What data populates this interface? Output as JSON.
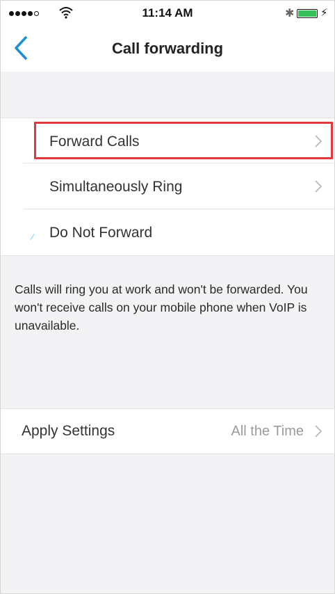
{
  "status_bar": {
    "time": "11:14 AM",
    "battery_level": 1.0,
    "icons": [
      "signal-icon",
      "wifi-icon",
      "bluetooth-icon",
      "battery-icon",
      "charging-icon"
    ]
  },
  "nav": {
    "back_icon": "chevron-left-icon",
    "title": "Call forwarding"
  },
  "options": [
    {
      "label": "Forward Calls",
      "has_chevron": true,
      "highlighted": true
    },
    {
      "label": "Simultaneously Ring",
      "has_chevron": true,
      "highlighted": false
    },
    {
      "label": "Do Not Forward",
      "has_chevron": false,
      "selected": true
    }
  ],
  "description": "Calls will ring you at work and won't be forwarded. You won't receive calls on your mobile phone when VoIP is unavailable.",
  "apply_settings": {
    "label": "Apply Settings",
    "value": "All the Time"
  },
  "colors": {
    "accent": "#1a8fd6",
    "highlight_border": "#e0393b",
    "background": "#f3f3f5"
  }
}
